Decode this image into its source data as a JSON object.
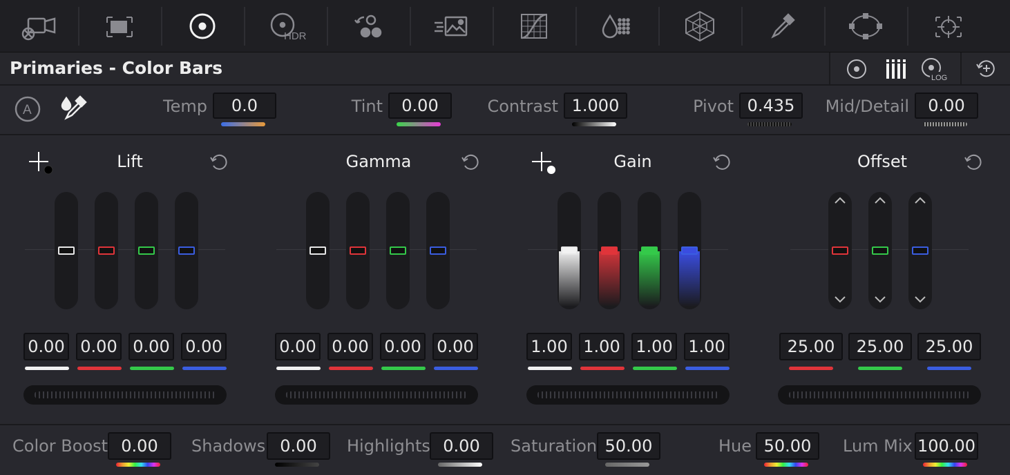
{
  "toolbar": {
    "tools": [
      {
        "icon": "camera-raw-icon"
      },
      {
        "icon": "color-match-icon"
      },
      {
        "icon": "color-wheels-icon",
        "active": true
      },
      {
        "icon": "hdr-wheels-icon",
        "text": "HDR"
      },
      {
        "icon": "rgb-mixer-icon"
      },
      {
        "icon": "motion-effects-icon"
      },
      {
        "icon": "curves-icon"
      },
      {
        "icon": "color-warper-icon"
      },
      {
        "icon": "qualifier-icon"
      },
      {
        "icon": "eyedropper-icon"
      },
      {
        "icon": "window-icon"
      },
      {
        "icon": "tracker-icon"
      }
    ]
  },
  "header": {
    "title": "Primaries - Color Bars",
    "mode_log_text": "LOG"
  },
  "top_params": {
    "temp": {
      "label": "Temp",
      "value": "0.0"
    },
    "tint": {
      "label": "Tint",
      "value": "0.00"
    },
    "contrast": {
      "label": "Contrast",
      "value": "1.000"
    },
    "pivot": {
      "label": "Pivot",
      "value": "0.435"
    },
    "mid_detail": {
      "label": "Mid/Detail",
      "value": "0.00"
    }
  },
  "wheels": {
    "lift": {
      "title": "Lift",
      "values": [
        "0.00",
        "0.00",
        "0.00",
        "0.00"
      ],
      "levels": [
        0,
        0,
        0,
        0
      ]
    },
    "gamma": {
      "title": "Gamma",
      "values": [
        "0.00",
        "0.00",
        "0.00",
        "0.00"
      ],
      "levels": [
        0,
        0,
        0,
        0
      ]
    },
    "gain": {
      "title": "Gain",
      "values": [
        "1.00",
        "1.00",
        "1.00",
        "1.00"
      ],
      "levels": [
        1,
        1,
        1,
        1
      ]
    },
    "offset": {
      "title": "Offset",
      "values": [
        "25.00",
        "25.00",
        "25.00"
      ]
    }
  },
  "bottom_params": {
    "color_boost": {
      "label": "Color Boost",
      "value": "0.00"
    },
    "shadows": {
      "label": "Shadows",
      "value": "0.00"
    },
    "highlights": {
      "label": "Highlights",
      "value": "0.00"
    },
    "saturation": {
      "label": "Saturation",
      "value": "50.00"
    },
    "hue": {
      "label": "Hue",
      "value": "50.00"
    },
    "lum_mix": {
      "label": "Lum Mix",
      "value": "100.00"
    }
  },
  "colors": {
    "white": "#e8e8e8",
    "red": "#e0343a",
    "green": "#34c94a",
    "blue": "#3a5de0"
  }
}
